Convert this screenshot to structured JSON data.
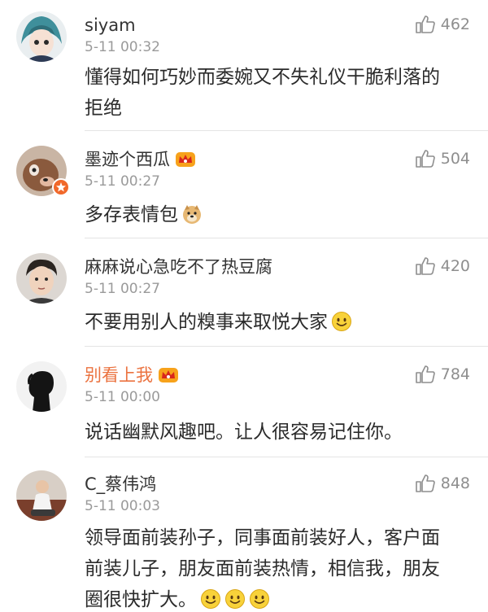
{
  "comments": [
    {
      "username": "siyam",
      "time": "5-11 00:32",
      "likes": "462",
      "text_lines": [
        "懂得如何巧妙而委婉又不失礼仪干脆利落的",
        "拒绝"
      ],
      "avatar": "anime-character-avatar"
    },
    {
      "username": "墨迹个西瓜",
      "badge": "vip-crown-icon",
      "time": "5-11 00:27",
      "likes": "504",
      "text": "多存表情包",
      "emoji": "doge-emoji",
      "avatar": "dog-photo-avatar"
    },
    {
      "username": "麻麻说心急吃不了热豆腐",
      "time": "5-11 00:27",
      "likes": "420",
      "text": "不要用别人的糗事来取悦大家",
      "emoji": "smile-emoji",
      "avatar": "man-portrait-avatar"
    },
    {
      "username": "别看上我",
      "badge": "vip-crown-icon",
      "time": "5-11 00:00",
      "likes": "784",
      "text": "说话幽默风趣吧。让人很容易记住你。",
      "avatar": "silhouette-avatar"
    },
    {
      "username": "C_蔡伟鸿",
      "time": "5-11 00:03",
      "likes": "848",
      "text_lines": [
        "领导面前装孙子，同事面前装好人，客户面",
        "前装儿子，朋友面前装热情，相信我，朋友",
        "圈很快扩大。"
      ],
      "emoji": "smile-emoji",
      "avatar": "man-sitting-avatar"
    }
  ],
  "colors": {
    "username": "#333333",
    "vip_username": "#eb7340",
    "time": "#9a9a9a",
    "like": "#8e8e8e",
    "divider": "#e4e4e4"
  }
}
